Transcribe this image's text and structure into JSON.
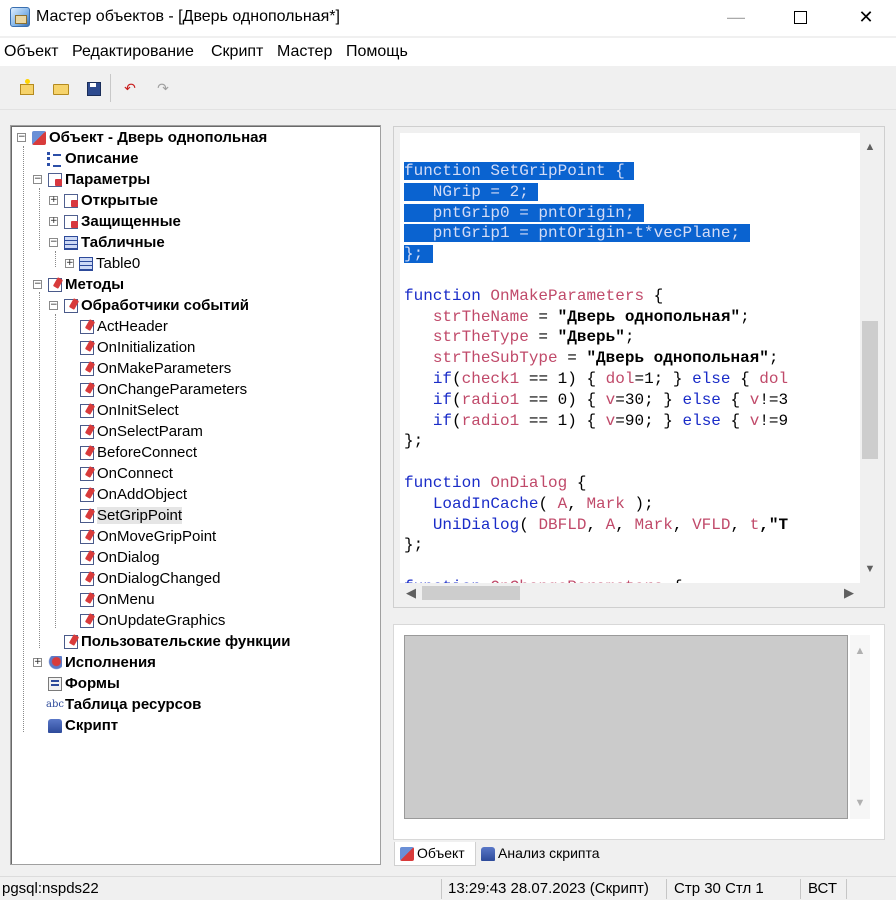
{
  "window": {
    "title": "Мастер объектов - [Дверь однопольная*]",
    "min_glyph": "—",
    "close_glyph": "✕"
  },
  "menu": [
    "Объект",
    "Редактирование",
    "Скрипт",
    "Мастер",
    "Помощь"
  ],
  "toolbar": {
    "icons": [
      "new-object-icon",
      "open-folder-icon",
      "save-icon",
      "undo-icon",
      "redo-icon"
    ],
    "undo_glyph": "↶",
    "redo_glyph": "↷"
  },
  "tree": {
    "root": "Объект - Дверь однопольная",
    "description": "Описание",
    "parameters": "Параметры",
    "open": "Открытые",
    "protected": "Защищенные",
    "tabular": "Табличные",
    "table0": "Table0",
    "methods": "Методы",
    "handlers": "Обработчики событий",
    "handler_items": [
      "ActHeader",
      "OnInitialization",
      "OnMakeParameters",
      "OnChangeParameters",
      "OnInitSelect",
      "OnSelectParam",
      "BeforeConnect",
      "OnConnect",
      "OnAddObject",
      "SetGripPoint",
      "OnMoveGripPoint",
      "OnDialog",
      "OnDialogChanged",
      "OnMenu",
      "OnUpdateGraphics"
    ],
    "selected_handler": "SetGripPoint",
    "user_functions": "Пользовательские функции",
    "executions": "Исполнения",
    "forms": "Формы",
    "resources": "Таблица ресурсов",
    "script": "Скрипт",
    "abc_glyph": "abc"
  },
  "code": {
    "lines": [
      [
        {
          "t": "function ",
          "c": "kw"
        },
        {
          "t": "SetGripPoint",
          "c": "kw"
        },
        {
          "t": " {",
          "c": "kw"
        }
      ],
      [
        {
          "t": "   NGrip = 2;",
          "c": "kw"
        }
      ],
      [
        {
          "t": "   pntGrip0 = pntOrigin;",
          "c": "kw"
        }
      ],
      [
        {
          "t": "   pntGrip1 = pntOrigin-t*vecPlane;",
          "c": "kw"
        }
      ],
      [
        {
          "t": "};",
          "c": ""
        }
      ],
      [
        {
          "t": "",
          "c": ""
        }
      ],
      [
        {
          "t": "function ",
          "c": "kw"
        },
        {
          "t": "OnMakeParameters",
          "c": "fn"
        },
        {
          "t": " {",
          "c": ""
        }
      ],
      [
        {
          "t": "   ",
          "c": ""
        },
        {
          "t": "strTheName",
          "c": "vr"
        },
        {
          "t": " = ",
          "c": ""
        },
        {
          "t": "\"Дверь однопольная\"",
          "c": "str"
        },
        {
          "t": ";",
          "c": ""
        }
      ],
      [
        {
          "t": "   ",
          "c": ""
        },
        {
          "t": "strTheType",
          "c": "vr"
        },
        {
          "t": " = ",
          "c": ""
        },
        {
          "t": "\"Дверь\"",
          "c": "str"
        },
        {
          "t": ";",
          "c": ""
        }
      ],
      [
        {
          "t": "   ",
          "c": ""
        },
        {
          "t": "strTheSubType",
          "c": "vr"
        },
        {
          "t": " = ",
          "c": ""
        },
        {
          "t": "\"Дверь однопольная\"",
          "c": "str"
        },
        {
          "t": ";",
          "c": ""
        }
      ],
      [
        {
          "t": "   ",
          "c": ""
        },
        {
          "t": "if",
          "c": "kw"
        },
        {
          "t": "(",
          "c": ""
        },
        {
          "t": "check1",
          "c": "vr"
        },
        {
          "t": " == 1) { ",
          "c": ""
        },
        {
          "t": "dol",
          "c": "vr"
        },
        {
          "t": "=1; } ",
          "c": ""
        },
        {
          "t": "else",
          "c": "kw"
        },
        {
          "t": " { ",
          "c": ""
        },
        {
          "t": "dol",
          "c": "vr"
        }
      ],
      [
        {
          "t": "   ",
          "c": ""
        },
        {
          "t": "if",
          "c": "kw"
        },
        {
          "t": "(",
          "c": ""
        },
        {
          "t": "radio1",
          "c": "vr"
        },
        {
          "t": " == 0) { ",
          "c": ""
        },
        {
          "t": "v",
          "c": "vr"
        },
        {
          "t": "=30; } ",
          "c": ""
        },
        {
          "t": "else",
          "c": "kw"
        },
        {
          "t": " { ",
          "c": ""
        },
        {
          "t": "v",
          "c": "vr"
        },
        {
          "t": "!=3",
          "c": ""
        }
      ],
      [
        {
          "t": "   ",
          "c": ""
        },
        {
          "t": "if",
          "c": "kw"
        },
        {
          "t": "(",
          "c": ""
        },
        {
          "t": "radio1",
          "c": "vr"
        },
        {
          "t": " == 1) { ",
          "c": ""
        },
        {
          "t": "v",
          "c": "vr"
        },
        {
          "t": "=90; } ",
          "c": ""
        },
        {
          "t": "else",
          "c": "kw"
        },
        {
          "t": " { ",
          "c": ""
        },
        {
          "t": "v",
          "c": "vr"
        },
        {
          "t": "!=9",
          "c": ""
        }
      ],
      [
        {
          "t": "};",
          "c": ""
        }
      ],
      [
        {
          "t": "",
          "c": ""
        }
      ],
      [
        {
          "t": "function ",
          "c": "kw"
        },
        {
          "t": "OnDialog",
          "c": "fn"
        },
        {
          "t": " {",
          "c": ""
        }
      ],
      [
        {
          "t": "   ",
          "c": ""
        },
        {
          "t": "LoadInCache",
          "c": "kw"
        },
        {
          "t": "( ",
          "c": ""
        },
        {
          "t": "A",
          "c": "vr"
        },
        {
          "t": ", ",
          "c": ""
        },
        {
          "t": "Mark",
          "c": "vr"
        },
        {
          "t": " );",
          "c": ""
        }
      ],
      [
        {
          "t": "   ",
          "c": ""
        },
        {
          "t": "UniDialog",
          "c": "kw"
        },
        {
          "t": "( ",
          "c": ""
        },
        {
          "t": "DBFLD",
          "c": "vr"
        },
        {
          "t": ", ",
          "c": ""
        },
        {
          "t": "A",
          "c": "vr"
        },
        {
          "t": ", ",
          "c": ""
        },
        {
          "t": "Mark",
          "c": "vr"
        },
        {
          "t": ", ",
          "c": ""
        },
        {
          "t": "VFLD",
          "c": "vr"
        },
        {
          "t": ", ",
          "c": ""
        },
        {
          "t": "t",
          "c": "vr"
        },
        {
          "t": ",\"Т",
          "c": "str"
        }
      ],
      [
        {
          "t": "};",
          "c": ""
        }
      ],
      [
        {
          "t": "",
          "c": ""
        }
      ],
      [
        {
          "t": "function ",
          "c": "kw"
        },
        {
          "t": "OnChangeParameters",
          "c": "fn"
        },
        {
          "t": " {",
          "c": ""
        }
      ]
    ],
    "selected_line_count": 5
  },
  "tabs": {
    "object": "Объект",
    "analysis": "Анализ скрипта"
  },
  "status": {
    "connection": "pgsql:nspds22",
    "datetime": "13:29:43  28.07.2023  (Скрипт)",
    "position": "Стр 30 Стл 1",
    "mode": "ВСТ"
  }
}
